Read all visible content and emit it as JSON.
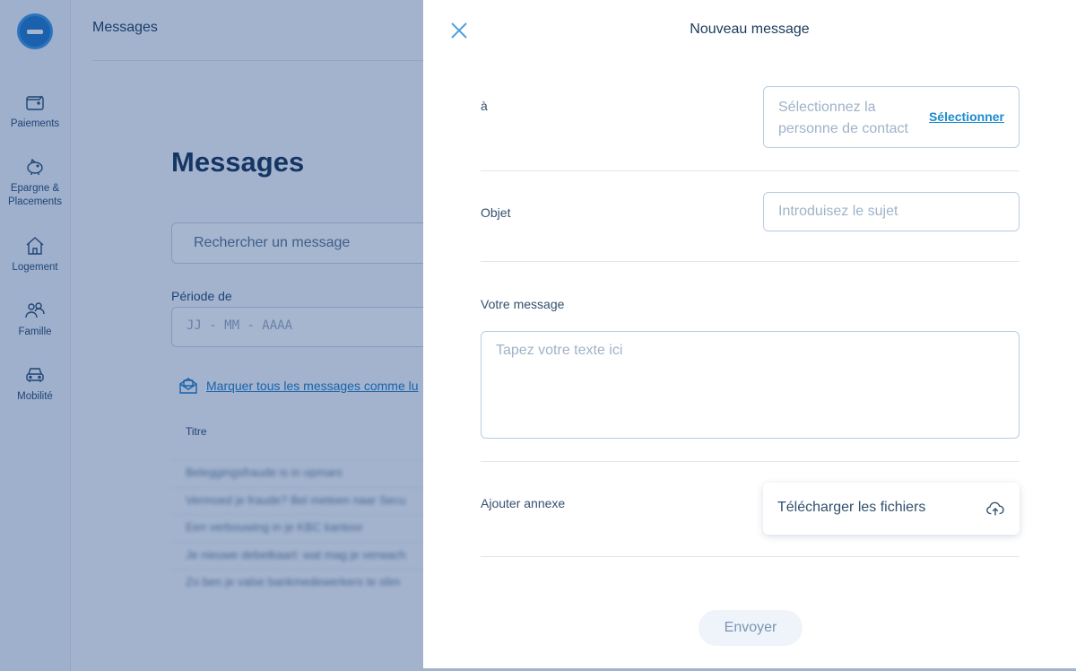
{
  "sidebar": {
    "items": [
      {
        "label": "Paiements",
        "icon": "wallet-icon"
      },
      {
        "label": "Epargne & Placements",
        "icon": "piggy-bank-icon"
      },
      {
        "label": "Logement",
        "icon": "house-icon"
      },
      {
        "label": "Famille",
        "icon": "family-icon"
      },
      {
        "label": "Mobilité",
        "icon": "car-icon"
      }
    ]
  },
  "header": {
    "title": "Messages"
  },
  "main": {
    "title": "Messages",
    "search_placeholder": "Rechercher un message",
    "period_label": "Période de",
    "date_placeholder": "JJ - MM - AAAA",
    "mark_all_read": "Marquer tous les messages comme lu",
    "column_title": "Titre",
    "messages": [
      "Beleggingsfraude is in opmars",
      "Vermoed je fraude? Bel meteen naar Secu",
      "Een verbouwing in je KBC kantoor",
      "Je nieuwe debetkaart: wat mag je verwach",
      "Zo ben je valse bankmedewerkers te slim"
    ]
  },
  "drawer": {
    "title": "Nouveau message",
    "to": {
      "label": "à",
      "placeholder": "Sélectionnez la personne de contact",
      "select_label": "Sélectionner"
    },
    "subject": {
      "label": "Objet",
      "placeholder": "Introduisez le sujet"
    },
    "message": {
      "label": "Votre message",
      "placeholder": "Tapez votre texte ici"
    },
    "attachment": {
      "label": "Ajouter annexe",
      "upload_label": "Télécharger les fichiers"
    },
    "send_label": "Envoyer"
  },
  "colors": {
    "accent": "#1a8bd0",
    "overlay": "#163e82",
    "text": "#1c3a5c"
  }
}
